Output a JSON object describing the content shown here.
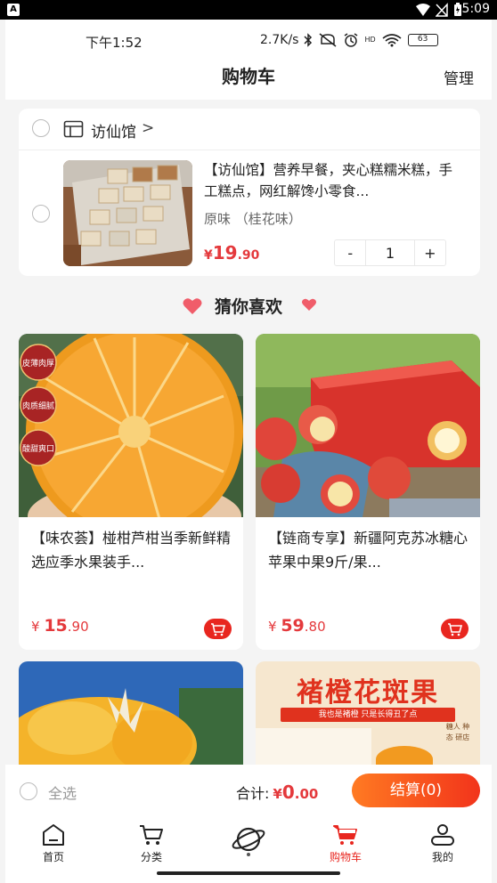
{
  "system_bar": {
    "badge": "A",
    "time": "5:09"
  },
  "status_bar": {
    "time": "下午1:52",
    "speed": "2.7K/s",
    "hd": "HD",
    "battery": "63"
  },
  "header": {
    "title": "购物车",
    "manage": "管理"
  },
  "cart": {
    "shop_name": "访仙馆",
    "shop_chevron": ">",
    "item": {
      "title": "【访仙馆】营养早餐，夹心糕糯米糕，手工糕点，网红解馋小零食...",
      "spec": "原味 （桂花味）",
      "price_symbol": "¥",
      "price_int": "19",
      "price_dec": ".90",
      "qty_minus": "-",
      "quantity": "1",
      "qty_plus": "+"
    }
  },
  "recommend": {
    "title": "猜你喜欢",
    "items": [
      {
        "title": "【味农荟】椪柑芦柑当季新鲜精选应季水果装手...",
        "price_symbol": "¥ ",
        "price_int": "15",
        "price_dec": ".90",
        "badges": [
          "皮薄肉厚",
          "肉质细腻",
          "酸甜爽口"
        ]
      },
      {
        "title": "【链商专享】新疆阿克苏冰糖心苹果中果9斤/果...",
        "price_symbol": "¥ ",
        "price_int": "59",
        "price_dec": ".80"
      },
      {
        "title": ""
      },
      {
        "title": "",
        "banner": "褚橙花斑果",
        "subbanner": "我也是褚橙 只是长得丑了点",
        "box_text": "糖人 种态 研店"
      }
    ]
  },
  "footer": {
    "select_all": "全选",
    "total_label": "合计:",
    "total_symbol": "¥",
    "total_int": "0",
    "total_dec": ".00",
    "checkout": "结算(0)"
  },
  "tabs": [
    {
      "label": "首页",
      "icon": "home-icon",
      "active": false
    },
    {
      "label": "分类",
      "icon": "cart-outline-icon",
      "active": false
    },
    {
      "label": "",
      "icon": "planet-icon",
      "active": false
    },
    {
      "label": "购物车",
      "icon": "cart-icon",
      "active": true
    },
    {
      "label": "我的",
      "icon": "user-icon",
      "active": false
    }
  ],
  "colors": {
    "accent": "#e4393c",
    "checkout_start": "#ff7a22",
    "checkout_end": "#f2341b",
    "active_tab": "#e8261f"
  }
}
